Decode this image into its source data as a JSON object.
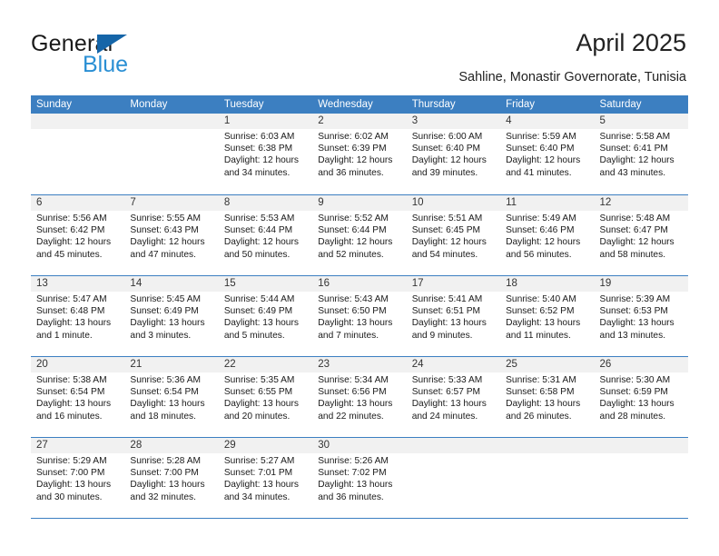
{
  "brand": {
    "name_top": "General",
    "name_bottom": "Blue",
    "triangle_icon": "blue-triangle-icon",
    "accent_color": "#2a8fd4",
    "logo_dark_color": "#1565a8"
  },
  "header": {
    "title": "April 2025",
    "subtitle": "Sahline, Monastir Governorate, Tunisia"
  },
  "colors": {
    "header_blue": "#3c7fc1",
    "band_gray": "#f1f1f1",
    "text": "#1a1a1a"
  },
  "weekdays": [
    "Sunday",
    "Monday",
    "Tuesday",
    "Wednesday",
    "Thursday",
    "Friday",
    "Saturday"
  ],
  "weeks": [
    [
      {
        "day": "",
        "lines": []
      },
      {
        "day": "",
        "lines": []
      },
      {
        "day": "1",
        "lines": [
          "Sunrise: 6:03 AM",
          "Sunset: 6:38 PM",
          "Daylight: 12 hours",
          "and 34 minutes."
        ]
      },
      {
        "day": "2",
        "lines": [
          "Sunrise: 6:02 AM",
          "Sunset: 6:39 PM",
          "Daylight: 12 hours",
          "and 36 minutes."
        ]
      },
      {
        "day": "3",
        "lines": [
          "Sunrise: 6:00 AM",
          "Sunset: 6:40 PM",
          "Daylight: 12 hours",
          "and 39 minutes."
        ]
      },
      {
        "day": "4",
        "lines": [
          "Sunrise: 5:59 AM",
          "Sunset: 6:40 PM",
          "Daylight: 12 hours",
          "and 41 minutes."
        ]
      },
      {
        "day": "5",
        "lines": [
          "Sunrise: 5:58 AM",
          "Sunset: 6:41 PM",
          "Daylight: 12 hours",
          "and 43 minutes."
        ]
      }
    ],
    [
      {
        "day": "6",
        "lines": [
          "Sunrise: 5:56 AM",
          "Sunset: 6:42 PM",
          "Daylight: 12 hours",
          "and 45 minutes."
        ]
      },
      {
        "day": "7",
        "lines": [
          "Sunrise: 5:55 AM",
          "Sunset: 6:43 PM",
          "Daylight: 12 hours",
          "and 47 minutes."
        ]
      },
      {
        "day": "8",
        "lines": [
          "Sunrise: 5:53 AM",
          "Sunset: 6:44 PM",
          "Daylight: 12 hours",
          "and 50 minutes."
        ]
      },
      {
        "day": "9",
        "lines": [
          "Sunrise: 5:52 AM",
          "Sunset: 6:44 PM",
          "Daylight: 12 hours",
          "and 52 minutes."
        ]
      },
      {
        "day": "10",
        "lines": [
          "Sunrise: 5:51 AM",
          "Sunset: 6:45 PM",
          "Daylight: 12 hours",
          "and 54 minutes."
        ]
      },
      {
        "day": "11",
        "lines": [
          "Sunrise: 5:49 AM",
          "Sunset: 6:46 PM",
          "Daylight: 12 hours",
          "and 56 minutes."
        ]
      },
      {
        "day": "12",
        "lines": [
          "Sunrise: 5:48 AM",
          "Sunset: 6:47 PM",
          "Daylight: 12 hours",
          "and 58 minutes."
        ]
      }
    ],
    [
      {
        "day": "13",
        "lines": [
          "Sunrise: 5:47 AM",
          "Sunset: 6:48 PM",
          "Daylight: 13 hours",
          "and 1 minute."
        ]
      },
      {
        "day": "14",
        "lines": [
          "Sunrise: 5:45 AM",
          "Sunset: 6:49 PM",
          "Daylight: 13 hours",
          "and 3 minutes."
        ]
      },
      {
        "day": "15",
        "lines": [
          "Sunrise: 5:44 AM",
          "Sunset: 6:49 PM",
          "Daylight: 13 hours",
          "and 5 minutes."
        ]
      },
      {
        "day": "16",
        "lines": [
          "Sunrise: 5:43 AM",
          "Sunset: 6:50 PM",
          "Daylight: 13 hours",
          "and 7 minutes."
        ]
      },
      {
        "day": "17",
        "lines": [
          "Sunrise: 5:41 AM",
          "Sunset: 6:51 PM",
          "Daylight: 13 hours",
          "and 9 minutes."
        ]
      },
      {
        "day": "18",
        "lines": [
          "Sunrise: 5:40 AM",
          "Sunset: 6:52 PM",
          "Daylight: 13 hours",
          "and 11 minutes."
        ]
      },
      {
        "day": "19",
        "lines": [
          "Sunrise: 5:39 AM",
          "Sunset: 6:53 PM",
          "Daylight: 13 hours",
          "and 13 minutes."
        ]
      }
    ],
    [
      {
        "day": "20",
        "lines": [
          "Sunrise: 5:38 AM",
          "Sunset: 6:54 PM",
          "Daylight: 13 hours",
          "and 16 minutes."
        ]
      },
      {
        "day": "21",
        "lines": [
          "Sunrise: 5:36 AM",
          "Sunset: 6:54 PM",
          "Daylight: 13 hours",
          "and 18 minutes."
        ]
      },
      {
        "day": "22",
        "lines": [
          "Sunrise: 5:35 AM",
          "Sunset: 6:55 PM",
          "Daylight: 13 hours",
          "and 20 minutes."
        ]
      },
      {
        "day": "23",
        "lines": [
          "Sunrise: 5:34 AM",
          "Sunset: 6:56 PM",
          "Daylight: 13 hours",
          "and 22 minutes."
        ]
      },
      {
        "day": "24",
        "lines": [
          "Sunrise: 5:33 AM",
          "Sunset: 6:57 PM",
          "Daylight: 13 hours",
          "and 24 minutes."
        ]
      },
      {
        "day": "25",
        "lines": [
          "Sunrise: 5:31 AM",
          "Sunset: 6:58 PM",
          "Daylight: 13 hours",
          "and 26 minutes."
        ]
      },
      {
        "day": "26",
        "lines": [
          "Sunrise: 5:30 AM",
          "Sunset: 6:59 PM",
          "Daylight: 13 hours",
          "and 28 minutes."
        ]
      }
    ],
    [
      {
        "day": "27",
        "lines": [
          "Sunrise: 5:29 AM",
          "Sunset: 7:00 PM",
          "Daylight: 13 hours",
          "and 30 minutes."
        ]
      },
      {
        "day": "28",
        "lines": [
          "Sunrise: 5:28 AM",
          "Sunset: 7:00 PM",
          "Daylight: 13 hours",
          "and 32 minutes."
        ]
      },
      {
        "day": "29",
        "lines": [
          "Sunrise: 5:27 AM",
          "Sunset: 7:01 PM",
          "Daylight: 13 hours",
          "and 34 minutes."
        ]
      },
      {
        "day": "30",
        "lines": [
          "Sunrise: 5:26 AM",
          "Sunset: 7:02 PM",
          "Daylight: 13 hours",
          "and 36 minutes."
        ]
      },
      {
        "day": "",
        "lines": []
      },
      {
        "day": "",
        "lines": []
      },
      {
        "day": "",
        "lines": []
      }
    ]
  ]
}
